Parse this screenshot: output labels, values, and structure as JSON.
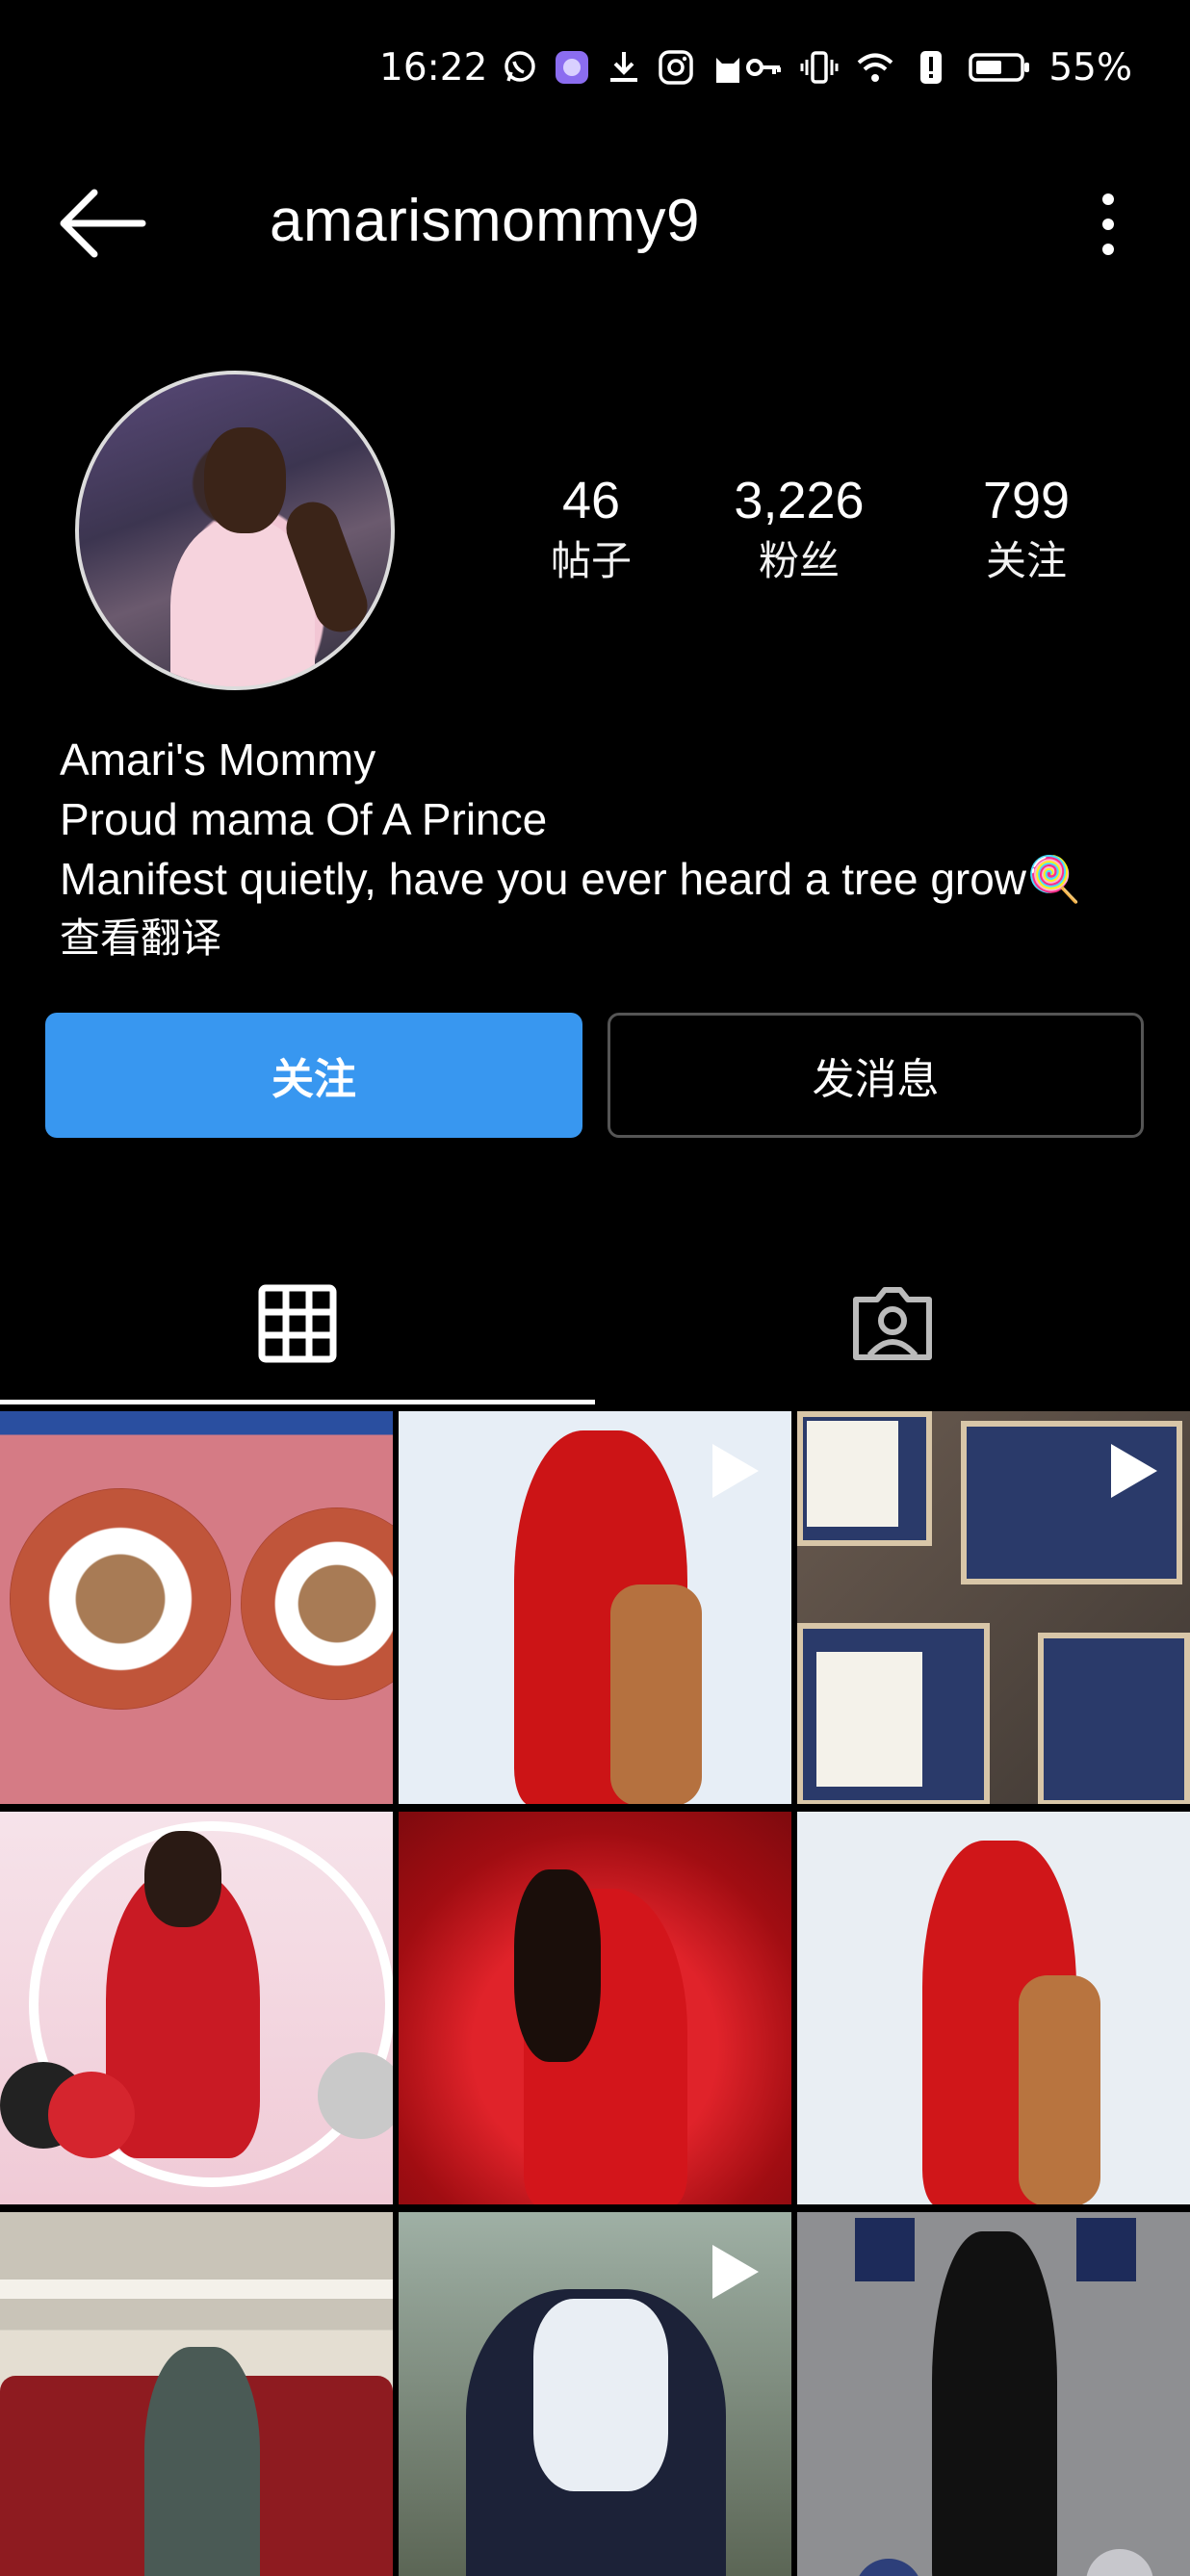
{
  "status_bar": {
    "time": "16:22",
    "battery": "55%",
    "icons_left": [
      "whatsapp-icon",
      "app-icon",
      "download-icon",
      "instagram-icon",
      "cat-icon"
    ],
    "icons_right": [
      "key-icon",
      "vibrate-icon",
      "wifi-icon",
      "alert-icon",
      "battery-icon"
    ]
  },
  "header": {
    "username": "amarismommy9",
    "back_icon": "back-arrow-icon",
    "more_icon": "more-vertical-icon"
  },
  "profile": {
    "stats": [
      {
        "value": "46",
        "label": "帖子"
      },
      {
        "value": "3,226",
        "label": "粉丝"
      },
      {
        "value": "799",
        "label": "关注"
      }
    ],
    "name": "Amari's Mommy",
    "bio_line1": "Proud mama Of A Prince",
    "bio_line2": "Manifest quietly, have you ever heard a tree grow🍭",
    "translate_link": "查看翻译"
  },
  "actions": {
    "follow": "关注",
    "message": "发消息",
    "follow_color": "#3897f0"
  },
  "tabs": [
    {
      "name": "grid-tab",
      "icon": "grid-icon",
      "active": true
    },
    {
      "name": "tagged-tab",
      "icon": "tagged-user-icon",
      "active": false
    }
  ],
  "posts": [
    {
      "subject": "food",
      "video": false
    },
    {
      "subject": "red-dress",
      "video": true
    },
    {
      "subject": "boxes",
      "video": true
    },
    {
      "subject": "portrait-pink",
      "video": false
    },
    {
      "subject": "red-backdrop",
      "video": false
    },
    {
      "subject": "red-dress-2",
      "video": false
    },
    {
      "subject": "child-couch",
      "video": false
    },
    {
      "subject": "outdoor",
      "video": true
    },
    {
      "subject": "black-dress",
      "video": false
    }
  ]
}
